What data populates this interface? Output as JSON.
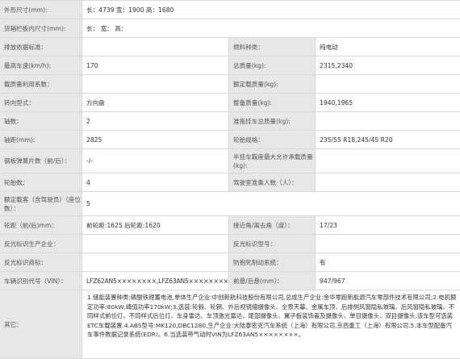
{
  "rows": [
    {
      "l1": "外形尺寸(mm):",
      "v1": "长：4739 宽：1900 高：1680"
    },
    {
      "l1": "货箱栏板内尺寸(mm):",
      "v1": "长：  宽：  高："
    },
    {
      "l1": "排放依据标准：",
      "v1": "",
      "l2": "燃料种类：",
      "v2": "纯电动"
    },
    {
      "l1": "最高车速(km/h):",
      "v1": "170",
      "l2": "总质量(kg):",
      "v2": "2315,2340"
    },
    {
      "l1": "载质量利用系数：",
      "v1": "",
      "l2": "额定载质量(kg):",
      "v2": ""
    },
    {
      "l1": "转向型式：",
      "v1": "方向盘",
      "l2": "整备质量(kg):",
      "v2": "1940,1965"
    },
    {
      "l1": "轴数：",
      "v1": "2",
      "l2": "准拖挂车总质量(kg):",
      "v2": ""
    },
    {
      "l1": "轴距(mm):",
      "v1": "2825",
      "l2": "轮胎规格：",
      "v2": "235/55 R18,245/45 R20"
    },
    {
      "l1": "钢板弹簧片数（前/后）：",
      "v1": "-/-",
      "l2": "半挂车鞍座最大允许承载质量(kg):",
      "v2": ""
    },
    {
      "l1": "轮胎数：",
      "v1": "4",
      "l2": "驾驶室准乘人数（人）：",
      "v2": ""
    },
    {
      "l1": "额定载客（含驾驶员）（座位数）：",
      "v1": "5"
    },
    {
      "l1": "轮距（前/后)mm：",
      "v1": "前轮距:1625 后轮距:1620",
      "l2": "接近角/离去角（度）：",
      "v2": "17/23"
    },
    {
      "l1": "反光标识生产企业：",
      "v1": "",
      "l2": "反光标识型号：",
      "v2": ""
    },
    {
      "l1": "反光标识商标：",
      "v1": "",
      "l2": "防抱死制动系统：",
      "v2": "有"
    },
    {
      "l1": "车辆识别代号（VIN）：",
      "v1": "LFZ62AN5××××××××,LFZ63AN5××××××××",
      "l2": "前悬/后悬(mm)：",
      "v2": "947/967"
    }
  ],
  "other": {
    "label": "其它：",
    "text": "1.储能装置种类:磷酸铁锂蓄电池,单体生产企业:中创新航科技股份有限公司,总成生产企业:金华零跑新能源汽车零部件技术有限公司;2.电机额定功率:80kW,峰值功率170kW;3.选装:轮毂、轮辋、外后视镜缩摄像头、全景天幕、金属车顶、后排侧风窗隐私玻璃、后风窗隐私玻璃、不同样式前位灯、不同样式后位灯、车身雷达、车顶激光雷达、尾部摄像头、翼子板装饰盖及摄像头、单目摄像头、双目摄像头,该车型可选装ETC车载装置.4.ABS型号:MK120,DBC1280,生产企业:大陆泰密克汽车系统（上海）有限公司,京西重工（上海）有限公司.5.本车型配备汽车事件数据记录系统(EDR)。6.当选装带气动时VIN为LFZ63AN5××××××××。"
  }
}
